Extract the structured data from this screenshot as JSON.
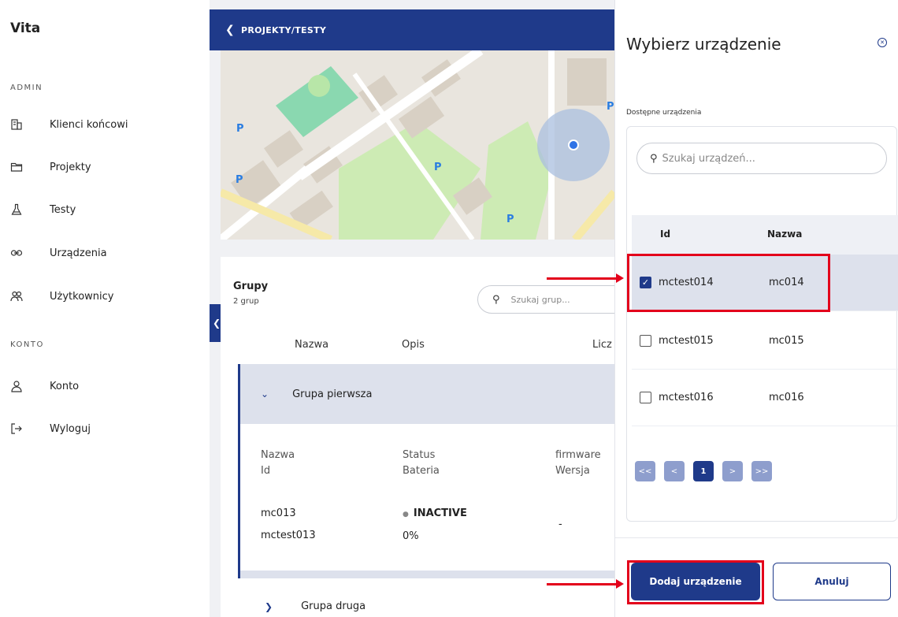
{
  "app": {
    "title": "Vita"
  },
  "sidebar": {
    "admin_title": "ADMIN",
    "konto_title": "KONTO",
    "admin_items": [
      {
        "label": "Klienci końcowi",
        "icon": "building-icon"
      },
      {
        "label": "Projekty",
        "icon": "folder-icon"
      },
      {
        "label": "Testy",
        "icon": "flask-icon"
      },
      {
        "label": "Urządzenia",
        "icon": "link-icon"
      },
      {
        "label": "Użytkownicy",
        "icon": "users-icon"
      }
    ],
    "konto_items": [
      {
        "label": "Konto",
        "icon": "user-icon"
      },
      {
        "label": "Wyloguj",
        "icon": "logout-icon"
      }
    ]
  },
  "main": {
    "breadcrumb": "PROJEKTY/TESTY",
    "groups": {
      "title": "Grupy",
      "count": "2 grup",
      "search_placeholder": "Szukaj grup...",
      "columns": [
        "Nazwa",
        "Opis",
        "Licz"
      ],
      "expanded_group": {
        "name": "Grupa pierwsza",
        "sub_headers": {
          "col1": [
            "Nazwa",
            "Id"
          ],
          "col2": [
            "Status",
            "Bateria"
          ],
          "col3": [
            "firmware",
            "Wersja"
          ]
        },
        "device": {
          "name": "mc013",
          "id": "mctest013",
          "status": "INACTIVE",
          "battery": "0%",
          "firmware": "-"
        }
      },
      "collapsed_group": {
        "name": "Grupa druga"
      }
    }
  },
  "panel": {
    "title": "Wybierz urządzenie",
    "available_label": "Dostępne urządzenia",
    "search_placeholder": "Szukaj urządzeń...",
    "table_headers": {
      "id": "Id",
      "name": "Nazwa"
    },
    "rows": [
      {
        "id": "mctest014",
        "name": "mc014",
        "checked": true
      },
      {
        "id": "mctest015",
        "name": "mc015",
        "checked": false
      },
      {
        "id": "mctest016",
        "name": "mc016",
        "checked": false
      }
    ],
    "pagination": {
      "first": "<<",
      "prev": "<",
      "current": "1",
      "next": ">",
      "last": ">>"
    },
    "add_button": "Dodaj urządzenie",
    "cancel_button": "Anuluj"
  },
  "colors": {
    "primary": "#1f3a8a",
    "highlight": "#e3001b",
    "selected_row": "#dde1ec"
  }
}
